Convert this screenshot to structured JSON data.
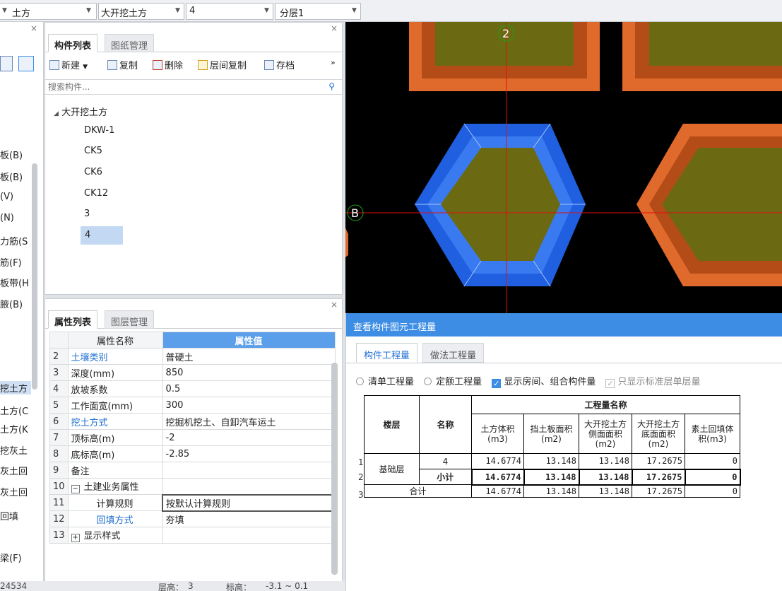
{
  "topbar": {
    "combo1": "土方",
    "combo2": "大开挖土方",
    "combo3": "4",
    "combo4": "分层1"
  },
  "leftpanel": {
    "items": [
      "板(B)",
      "板(B)",
      "(V)",
      "(N)",
      "力筋(S",
      "筋(F)",
      "板带(H",
      "腋(B)",
      "挖土方",
      "土方(C",
      "土方(K",
      "挖灰土",
      "灰土回",
      "灰土回",
      "回填",
      "梁(F)"
    ],
    "status_left": "24534"
  },
  "complist": {
    "tabs": [
      "构件列表",
      "图纸管理"
    ],
    "toolbar": {
      "new": "新建",
      "copy": "复制",
      "delete": "删除",
      "layer_copy": "层间复制",
      "save": "存档",
      "more": "»"
    },
    "search_placeholder": "搜索构件...",
    "tree": {
      "root": "大开挖土方",
      "children": [
        "DKW-1",
        "CK5",
        "CK6",
        "CK12",
        "3",
        "4"
      ],
      "selected": "4"
    }
  },
  "proppanel": {
    "tabs": [
      "属性列表",
      "图层管理"
    ],
    "header": {
      "name": "属性名称",
      "value": "属性值"
    },
    "rows": [
      {
        "num": "2",
        "name": "土壤类别",
        "value": "普硬土",
        "blue": true
      },
      {
        "num": "3",
        "name": "深度(mm)",
        "value": "850"
      },
      {
        "num": "4",
        "name": "放坡系数",
        "value": "0.5"
      },
      {
        "num": "5",
        "name": "工作面宽(mm)",
        "value": "300"
      },
      {
        "num": "6",
        "name": "挖土方式",
        "value": "挖掘机挖土、自卸汽车运土",
        "blue": true
      },
      {
        "num": "7",
        "name": "顶标高(m)",
        "value": "-2"
      },
      {
        "num": "8",
        "name": "底标高(m)",
        "value": "-2.85"
      },
      {
        "num": "9",
        "name": "备注",
        "value": ""
      },
      {
        "num": "10",
        "name": "土建业务属性",
        "value": "",
        "toggle": "−"
      },
      {
        "num": "11",
        "name": "计算规则",
        "value": "按默认计算规则",
        "selected": true
      },
      {
        "num": "12",
        "name": "回填方式",
        "value": "夯填",
        "blue": true
      },
      {
        "num": "13",
        "name": "显示样式",
        "value": "",
        "toggle": "+"
      }
    ]
  },
  "status": {
    "floor_label": "层高：",
    "floor_value": "3",
    "elev_label": "标高：",
    "elev_value": "-3.1 ~ 0.1"
  },
  "canvas": {
    "axis_2": "2",
    "axis_B": "B"
  },
  "qdialog": {
    "title": "查看构件图元工程量",
    "tabs": [
      "构件工程量",
      "做法工程量"
    ],
    "options": {
      "opt1": "清单工程量",
      "opt2": "定额工程量",
      "opt3": "显示房间、组合构件量",
      "opt4": "只显示标准层单层量"
    },
    "table": {
      "h_floor": "楼层",
      "h_name": "名称",
      "h_group": "工程量名称",
      "cols": [
        "土方体积(m3)",
        "挡土板面积(m2)",
        "大开挖土方侧面面积(m2)",
        "大开挖土方底面面积(m2)",
        "素土回填体积(m3)"
      ],
      "floor": "基础层",
      "rows": [
        {
          "rownum": "1",
          "name": "4",
          "values": [
            "14.6774",
            "13.148",
            "13.148",
            "17.2675",
            "0"
          ]
        },
        {
          "rownum": "2",
          "name": "小计",
          "values": [
            "14.6774",
            "13.148",
            "13.148",
            "17.2675",
            "0"
          ],
          "bold": true
        },
        {
          "rownum": "3",
          "name": "合计",
          "values": [
            "14.6774",
            "13.148",
            "13.148",
            "17.2675",
            "0"
          ]
        }
      ]
    }
  },
  "colors": {
    "accent": "#3c8de3",
    "orange_pit": "#e06a2c",
    "blue_pit": "#1f5fe0",
    "pit_fill": "#6b6a12"
  }
}
